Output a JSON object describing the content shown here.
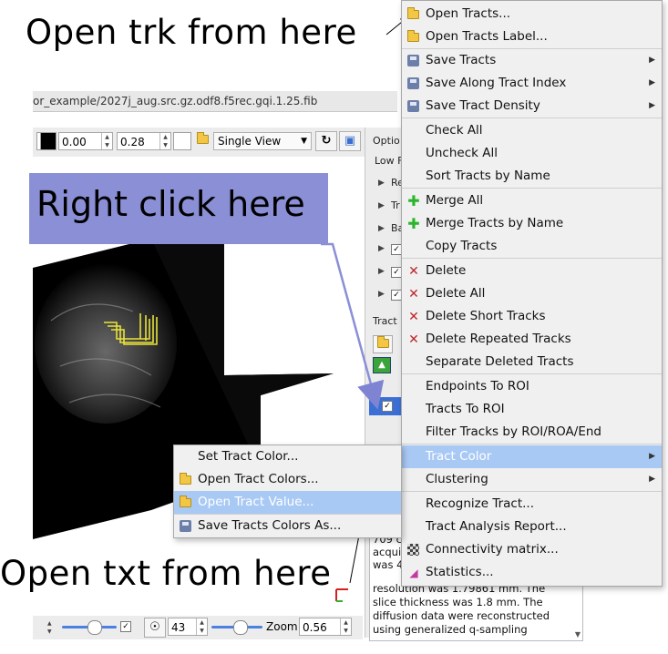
{
  "annotations": {
    "open_trk": "Open trk from here",
    "right_click": "Right click here",
    "open_txt": "Open txt from here"
  },
  "window": {
    "title": "or_example/2027j_aug.src.gz.odf8.f5rec.gqi.1.25.fib"
  },
  "toolbar": {
    "value1": "0.00",
    "value2": "0.28",
    "view_mode": "Single View"
  },
  "right_panel": {
    "options_label": "Optio",
    "low_label": "Low F",
    "items": [
      "Re",
      "Tr",
      "Ba"
    ],
    "tract_label": "Tract"
  },
  "bottom_bar": {
    "slice_value": "43",
    "zoom_label": "Zoom",
    "zoom_value": "0.56"
  },
  "info_text": {
    "lines": [
      "709 c",
      "acqui",
      "was 4",
      "resolution was 1.79861 mm. The",
      "slice thickness was 1.8 mm. The",
      "diffusion data were reconstructed",
      "using generalized q-sampling"
    ]
  },
  "main_menu": {
    "items": [
      {
        "label": "Open Tracts...",
        "icon": "folder-icon"
      },
      {
        "label": "Open Tracts Label...",
        "icon": "folder-icon"
      },
      {
        "label": "Save Tracts",
        "icon": "disk-icon",
        "submenu": true
      },
      {
        "label": "Save Along Tract Index",
        "icon": "disk-icon",
        "submenu": true
      },
      {
        "label": "Save Tract Density",
        "icon": "disk-icon",
        "submenu": true
      },
      {
        "label": "Check All"
      },
      {
        "label": "Uncheck All"
      },
      {
        "label": "Sort Tracts by Name"
      },
      {
        "label": "Merge All",
        "icon": "plus-icon"
      },
      {
        "label": "Merge Tracts by Name",
        "icon": "plus-icon"
      },
      {
        "label": "Copy Tracts"
      },
      {
        "label": "Delete",
        "icon": "x-icon"
      },
      {
        "label": "Delete All",
        "icon": "x-icon"
      },
      {
        "label": "Delete Short Tracks",
        "icon": "x-icon"
      },
      {
        "label": "Delete Repeated Tracks",
        "icon": "x-icon"
      },
      {
        "label": "Separate Deleted Tracts"
      },
      {
        "label": "Endpoints To ROI"
      },
      {
        "label": "Tracts To ROI"
      },
      {
        "label": "Filter Tracks by ROI/ROA/End"
      },
      {
        "label": "Tract Color",
        "submenu": true,
        "highlighted": true
      },
      {
        "label": "Clustering",
        "submenu": true
      },
      {
        "label": "Recognize Tract..."
      },
      {
        "label": "Tract Analysis Report..."
      },
      {
        "label": "Connectivity matrix...",
        "icon": "matrix-icon"
      },
      {
        "label": "Statistics...",
        "icon": "chart-icon"
      }
    ]
  },
  "color_menu": {
    "items": [
      {
        "label": "Set Tract Color..."
      },
      {
        "label": "Open Tract Colors...",
        "icon": "folder-icon"
      },
      {
        "label": "Open Tract Value...",
        "icon": "folder-icon",
        "highlighted": true
      },
      {
        "label": "Save Tracts Colors As...",
        "icon": "disk-icon"
      }
    ]
  },
  "colors": {
    "callout_bg": "#8a8fd6",
    "highlight": "#a9c9f5",
    "menu_bg": "#f0f0f0",
    "delete_x": "#c0262b",
    "plus": "#2cb52c",
    "tract_yellow": "#e8e23a"
  }
}
